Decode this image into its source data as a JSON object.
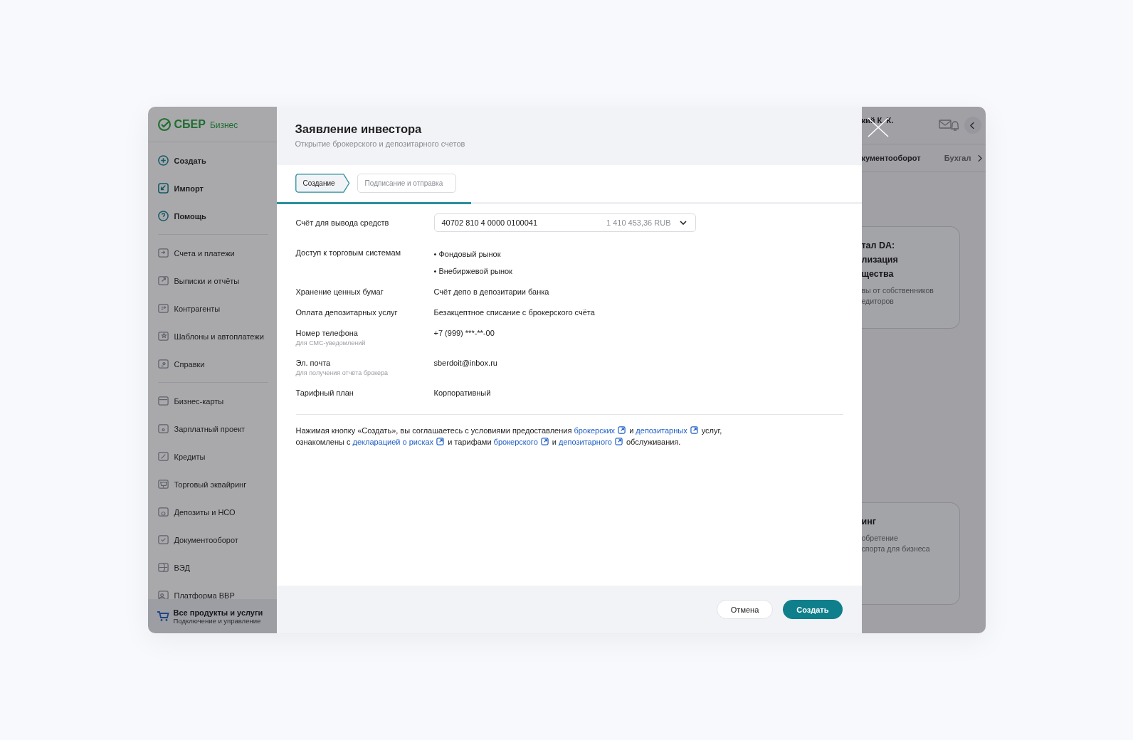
{
  "brand": {
    "name": "СБЕР",
    "suffix": "Бизнес"
  },
  "sidebar": {
    "actions": [
      {
        "label": "Создать"
      },
      {
        "label": "Импорт"
      },
      {
        "label": "Помощь"
      }
    ],
    "sections": [
      [
        {
          "label": "Счета и платежи"
        },
        {
          "label": "Выписки и отчёты"
        },
        {
          "label": "Контрагенты"
        },
        {
          "label": "Шаблоны и автоплатежи"
        },
        {
          "label": "Справки"
        }
      ],
      [
        {
          "label": "Бизнес-карты"
        },
        {
          "label": "Зарплатный проект"
        },
        {
          "label": "Кредиты"
        },
        {
          "label": "Торговый эквайринг"
        },
        {
          "label": "Депозиты и НСО"
        },
        {
          "label": "Документооборот"
        },
        {
          "label": "ВЭД"
        },
        {
          "label": "Платформа ВВР"
        }
      ]
    ],
    "footer": {
      "title": "Все продукты и услуги",
      "subtitle": "Подключение и управление"
    }
  },
  "background": {
    "user": "кий К. К.",
    "nav": [
      "кументооборот",
      "Бухгал"
    ],
    "cards": [
      {
        "title_lines": [
          "тал DA:",
          "лизация",
          "щества"
        ],
        "text_lines": [
          "вы от собственников",
          "едиторов"
        ]
      },
      {
        "title_lines": [
          "инг"
        ],
        "text_lines": [
          "обретение",
          "спорта для бизнеса"
        ]
      }
    ]
  },
  "modal": {
    "title": "Заявление инвестора",
    "subtitle": "Открытие брокерского и депозитарного счетов",
    "steps": [
      {
        "label": "Создание",
        "selected": true
      },
      {
        "label": "Подписание и отправка",
        "selected": false
      }
    ],
    "progress": {
      "level": 0.333
    },
    "fields": [
      {
        "kind": "select",
        "label": "Счёт для вывода средств",
        "value": "40702 810 4 0000 0100041",
        "amount": "1 410 453,36 RUB"
      },
      {
        "kind": "list",
        "label": "Доступ к торговым системам",
        "items": [
          "• Фондовый рынок",
          "• Внебиржевой рынок"
        ]
      },
      {
        "kind": "text",
        "label": "Хранение ценных бумаг",
        "value": "Счёт депо в депозитарии банка"
      },
      {
        "kind": "text",
        "label": "Оплата депозитарных услуг",
        "value": "Безакцептное списание с брокерского счёта"
      },
      {
        "kind": "text",
        "label": "Номер телефона",
        "hint": "Для СМС-уведомлений",
        "value": "+7 (999) ***-**-00"
      },
      {
        "kind": "text",
        "label": "Эл. почта",
        "hint": "Для получения отчёта брокера",
        "value": "sberdoit@inbox.ru"
      },
      {
        "kind": "text",
        "label": "Тарифный план",
        "value": "Корпоративный"
      }
    ],
    "consent_lines": [
      [
        {
          "kind": "text",
          "text": "Нажимая кнопку «Создать», вы соглашаетесь с условиями предоставления "
        },
        {
          "kind": "link",
          "text": "брокерских"
        },
        {
          "kind": "text",
          "text": " и "
        },
        {
          "kind": "link",
          "text": "депозитарных"
        },
        {
          "kind": "text",
          "text": " услуг,"
        }
      ],
      [
        {
          "kind": "text",
          "text": "ознакомлены с "
        },
        {
          "kind": "link",
          "text": "декларацией о рисках"
        },
        {
          "kind": "text",
          "text": " и тарифами "
        },
        {
          "kind": "link",
          "text": "брокерского"
        },
        {
          "kind": "text",
          "text": " и "
        },
        {
          "kind": "link",
          "text": "депозитарного"
        },
        {
          "kind": "text",
          "text": " обслуживания."
        }
      ]
    ],
    "buttons": [
      {
        "kind": "secondary",
        "label": "Отмена"
      },
      {
        "kind": "primary",
        "label": "Создать"
      }
    ]
  }
}
